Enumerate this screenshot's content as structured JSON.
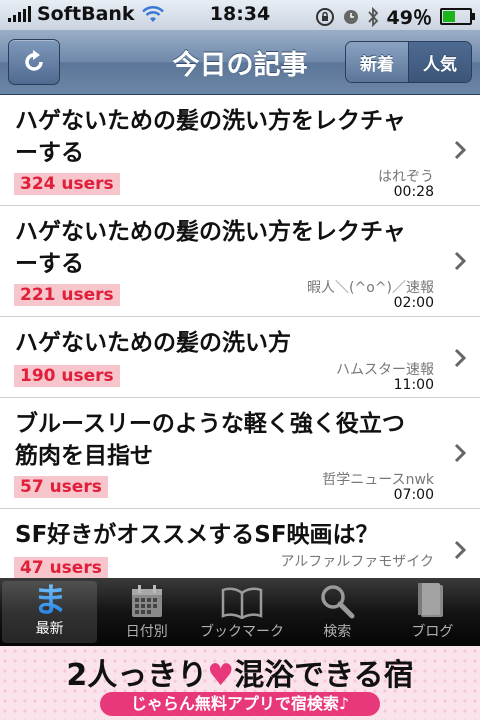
{
  "status_bar": {
    "carrier": "SoftBank",
    "time": "18:34",
    "battery_text": "49％",
    "battery_level": 0.49
  },
  "nav": {
    "title": "今日の記事",
    "segments": [
      "新着",
      "人気"
    ],
    "selected_segment": "人気"
  },
  "articles": [
    {
      "title": "ハゲないための髪の洗い方をレクチャーする",
      "users": "324 users",
      "source": "はれぞう",
      "time": "00:28"
    },
    {
      "title": "ハゲないための髪の洗い方をレクチャーする",
      "users": "221 users",
      "source": "暇人＼(^o^)／速報",
      "time": "02:00"
    },
    {
      "title": "ハゲないための髪の洗い方",
      "users": "190 users",
      "source": "ハムスター速報",
      "time": "11:00"
    },
    {
      "title": "ブルースリーのような軽く強く役立つ筋肉を目指せ",
      "users": "57 users",
      "source": "哲学ニュースnwk",
      "time": "07:00"
    },
    {
      "title": "SF好きがオススメするSF映画は？",
      "users": "47 users",
      "source": "アルファルファモザイク",
      "time": ""
    }
  ],
  "tabs": [
    {
      "label": "最新",
      "icon": "ma-icon"
    },
    {
      "label": "日付別",
      "icon": "calendar-icon"
    },
    {
      "label": "ブックマーク",
      "icon": "book-icon"
    },
    {
      "label": "検索",
      "icon": "search-icon"
    },
    {
      "label": "ブログ",
      "icon": "books-icon"
    }
  ],
  "selected_tab": "最新",
  "ad": {
    "headline_part1": "2人っきり",
    "headline_part2": "混浴できる宿",
    "subline": "じゃらん無料アプリで宿検索♪"
  },
  "colors": {
    "users_badge_bg": "#f7c6cc",
    "users_badge_text": "#e0203a",
    "nav_bar": "#6f89ab",
    "ad_accent": "#e8387a"
  }
}
